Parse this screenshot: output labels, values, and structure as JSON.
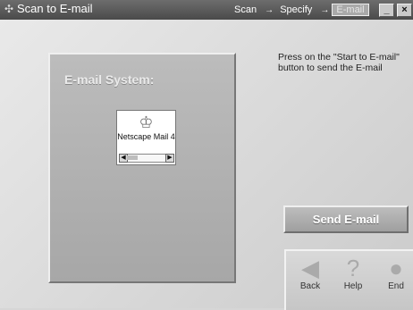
{
  "window": {
    "title": "Scan to E-mail",
    "steps": [
      "Scan",
      "Specify",
      "E-mail"
    ],
    "active_step": "E-mail",
    "minimize": "_",
    "close": "×"
  },
  "panel": {
    "label": "E-mail System:",
    "item_label": "Netscape Mail 4"
  },
  "instructions": "Press on the \"Start to E-mail\" button to send the E-mail",
  "actions": {
    "send": "Send E-mail"
  },
  "nav": {
    "back": "Back",
    "help": "Help",
    "end": "End"
  },
  "icons": {
    "app": "scan-icon",
    "mail": "netscape-icon",
    "back": "back-arrow-icon",
    "help": "question-icon",
    "end": "end-icon"
  }
}
